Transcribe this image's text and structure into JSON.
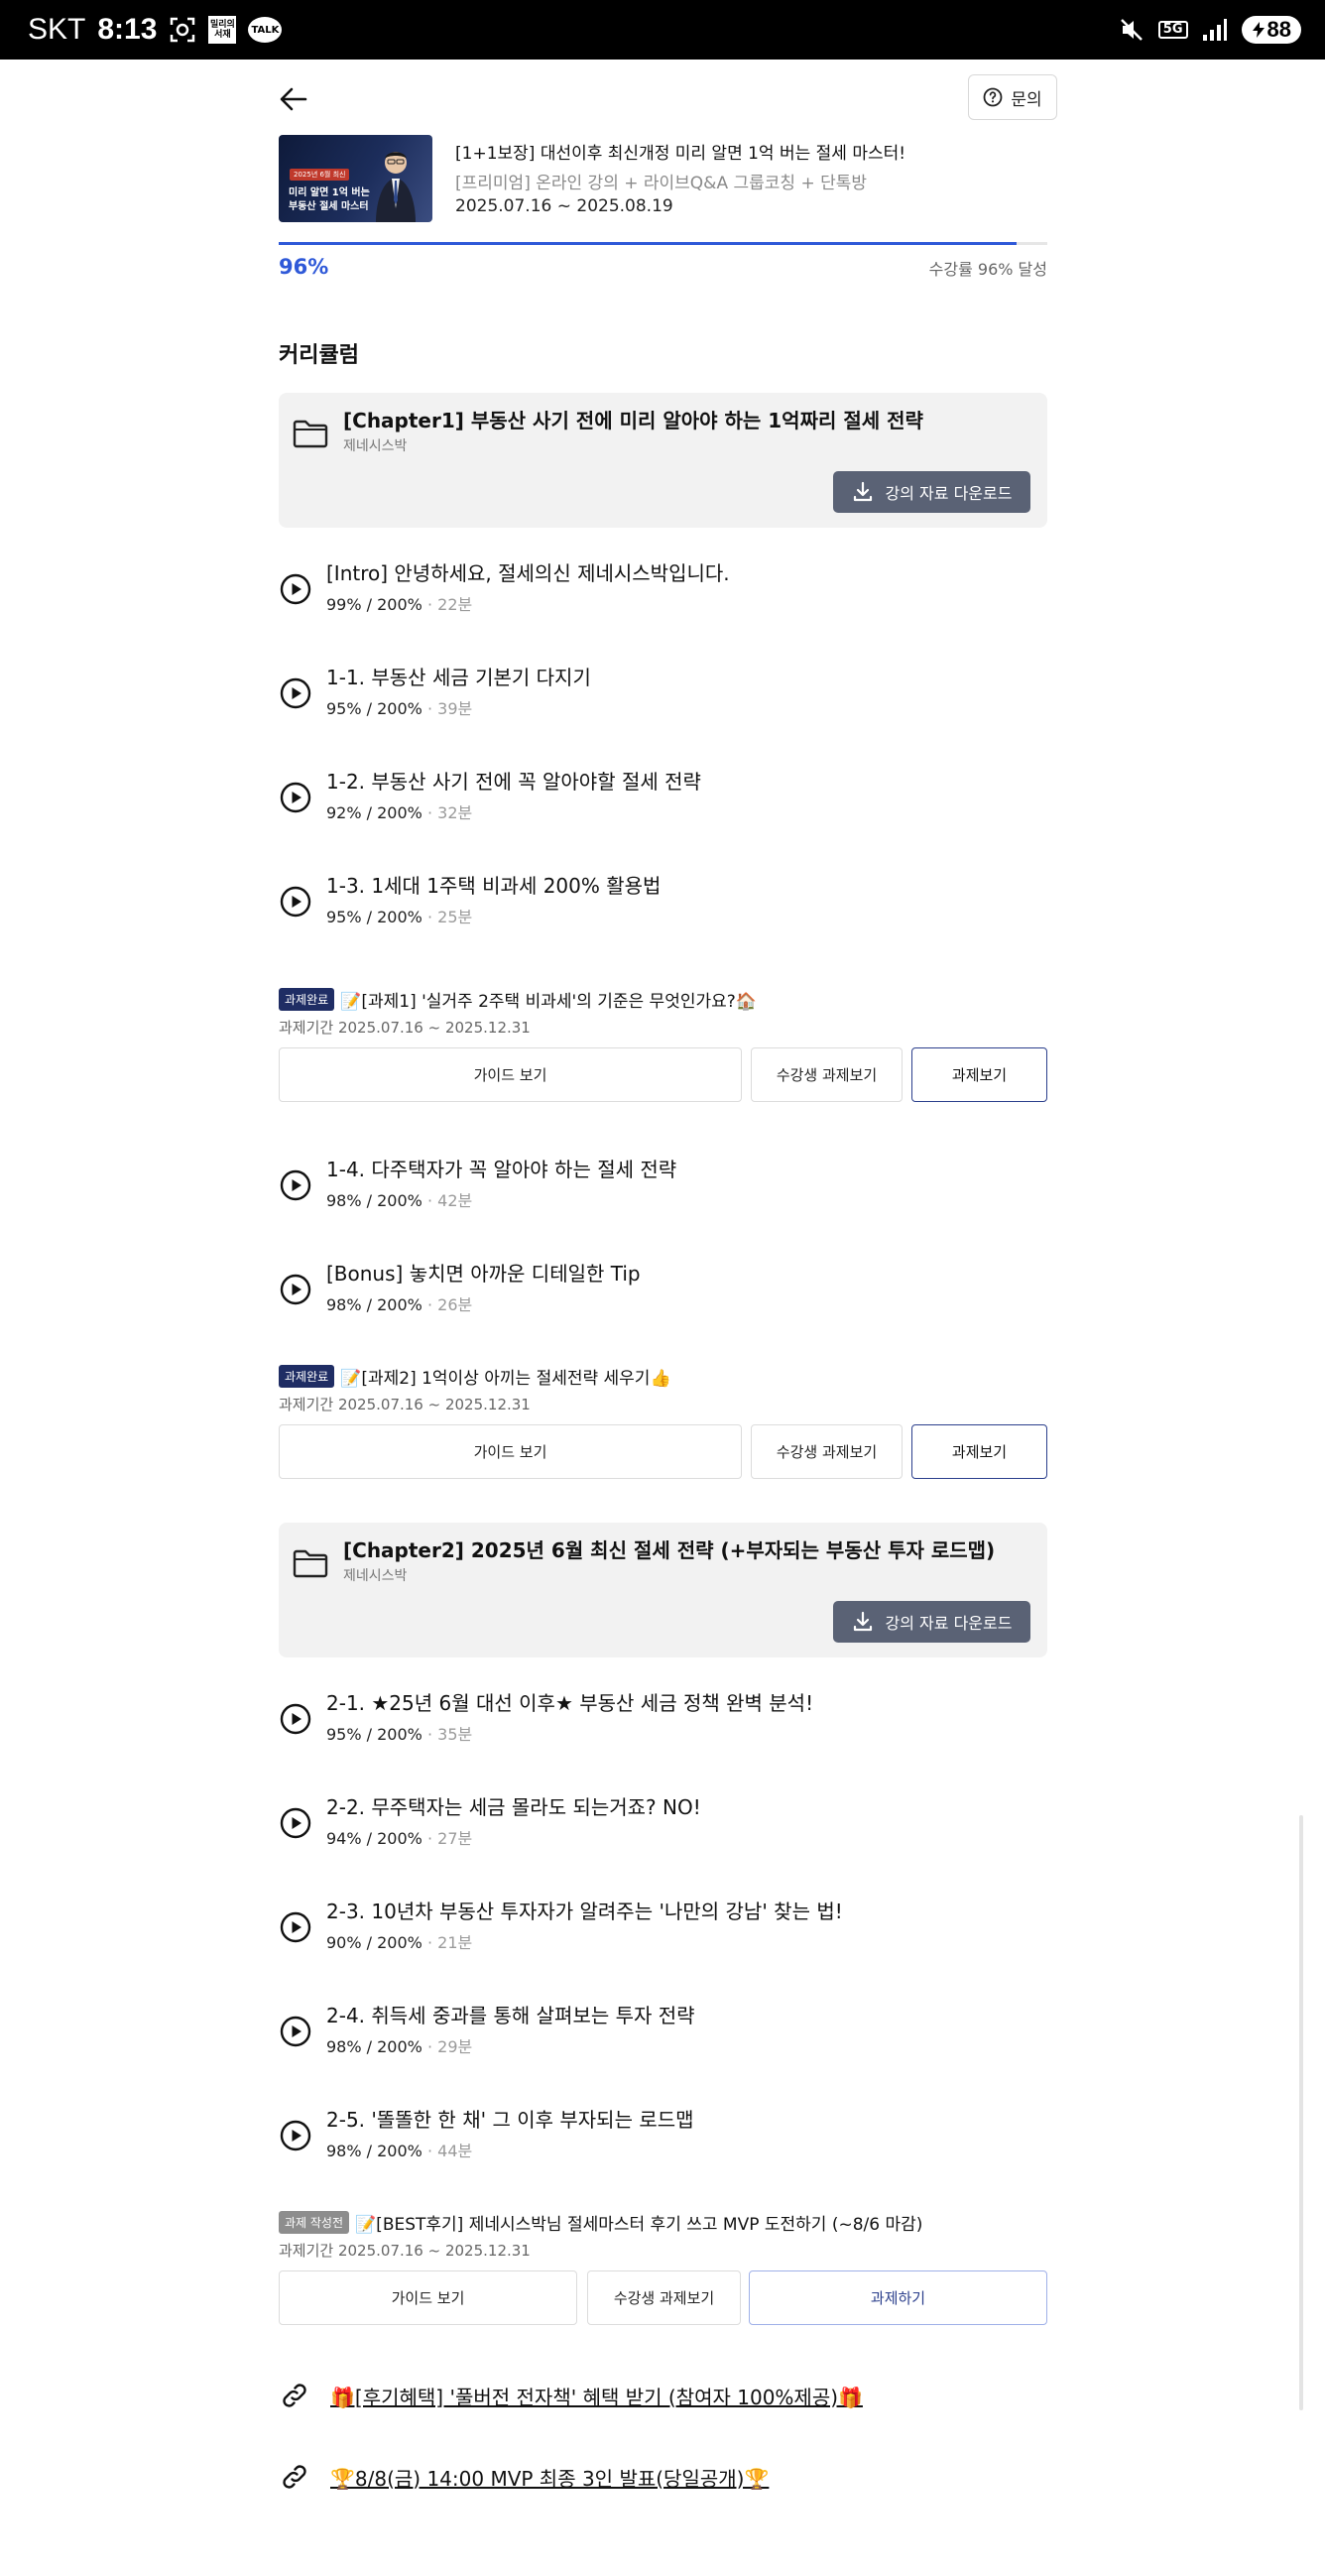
{
  "status_bar": {
    "carrier": "SKT",
    "time": "8:13",
    "app_icon_box": "밀리의 서재",
    "app_icon_talk": "TALK",
    "network": "5G",
    "battery": "88"
  },
  "header": {
    "inquiry_label": "문의"
  },
  "course": {
    "thumb_tag": "2025년 6월 최신",
    "thumb_line1": "미리 알면 1억 버는",
    "thumb_line2": "부동산 절세 마스터",
    "title": "[1+1보장] 대선이후 최신개정 미리 알면 1억 버는 절세 마스터!",
    "subtitle": "[프리미엄] 온라인 강의 + 라이브Q&A 그룹코칭 + 단톡방",
    "date_range": "2025.07.16 ~ 2025.08.19",
    "progress_value": 0.96,
    "progress_label": "96%",
    "progress_note": "수강률 96% 달성"
  },
  "curriculum": {
    "title": "커리큘럼",
    "download_label": "강의 자료 다운로드",
    "guide_label": "가이드 보기",
    "peer_label": "수강생 과제보기",
    "view_label": "과제보기",
    "write_label": "과제하기",
    "period_prefix": "과제기간",
    "chapters": [
      {
        "title": "[Chapter1] 부동산 사기 전에 미리 알아야 하는 1억짜리 절세 전략",
        "author": "제네시스박"
      },
      {
        "title": "[Chapter2] 2025년 6월 최신 절세 전략 (+부자되는 부동산 투자 로드맵)",
        "author": "제네시스박"
      }
    ],
    "lessons": [
      {
        "title": "[Intro] 안녕하세요, 절세의신 제네시스박입니다.",
        "progress": "99% / 200%",
        "sep": "·",
        "duration": "22분"
      },
      {
        "title": "1-1. 부동산 세금 기본기 다지기",
        "progress": "95% / 200%",
        "sep": "·",
        "duration": "39분"
      },
      {
        "title": "1-2. 부동산 사기 전에 꼭 알아야할 절세 전략",
        "progress": "92% / 200%",
        "sep": "·",
        "duration": "32분"
      },
      {
        "title": "1-3. 1세대 1주택 비과세 200% 활용법",
        "progress": "95% / 200%",
        "sep": "·",
        "duration": "25분"
      },
      {
        "title": "1-4. 다주택자가 꼭 알아야 하는 절세 전략",
        "progress": "98% / 200%",
        "sep": "·",
        "duration": "42분"
      },
      {
        "title": "[Bonus] 놓치면 아까운 디테일한 Tip",
        "progress": "98% / 200%",
        "sep": "·",
        "duration": "26분"
      },
      {
        "title": "2-1. ★25년 6월 대선 이후★ 부동산 세금 정책 완벽 분석!",
        "progress": "95% / 200%",
        "sep": "·",
        "duration": "35분"
      },
      {
        "title": "2-2. 무주택자는 세금 몰라도 되는거죠? NO!",
        "progress": "94% / 200%",
        "sep": "·",
        "duration": "27분"
      },
      {
        "title": "2-3. 10년차 부동산 투자자가 알려주는 '나만의 강남' 찾는 법!",
        "progress": "90% / 200%",
        "sep": "·",
        "duration": "21분"
      },
      {
        "title": "2-4. 취득세 중과를 통해 살펴보는 투자 전략",
        "progress": "98% / 200%",
        "sep": "·",
        "duration": "29분"
      },
      {
        "title": "2-5. '똘똘한 한 채' 그 이후 부자되는 로드맵",
        "progress": "98% / 200%",
        "sep": "·",
        "duration": "44분"
      }
    ],
    "assignments": [
      {
        "badge": "과제완료",
        "title": "📝[과제1] '실거주 2주택 비과세'의 기준은 무엇인가요?🏠",
        "period": "과제기간 2025.07.16 ~ 2025.12.31"
      },
      {
        "badge": "과제완료",
        "title": "📝[과제2] 1억이상 아끼는 절세전략 세우기👍",
        "period": "과제기간 2025.07.16 ~ 2025.12.31"
      },
      {
        "badge": "과제 작성전",
        "title": "📝[BEST후기] 제네시스박님 절세마스터 후기 쓰고 MVP 도전하기 (~8/6 마감)",
        "period": "과제기간 2025.07.16 ~ 2025.12.31"
      }
    ],
    "links": [
      {
        "text": "🎁[후기혜택] '풀버전 전자책' 혜택 받기 (참여자 100%제공)🎁"
      },
      {
        "text": "🏆8/8(금) 14:00 MVP 최종 3인 발표(당일공개)🏆"
      }
    ]
  },
  "colors": {
    "accent": "#2f59d8",
    "download_button": "#5a6275",
    "badge_done": "#1f2d64",
    "badge_pending": "#8d8d8d",
    "chapter_bg": "#f2f2f2"
  },
  "icons": [
    "back-arrow-icon",
    "question-circle-icon",
    "folder-icon",
    "download-icon",
    "play-circle-icon",
    "link-icon",
    "mute-icon",
    "signal-icon",
    "battery-icon"
  ]
}
